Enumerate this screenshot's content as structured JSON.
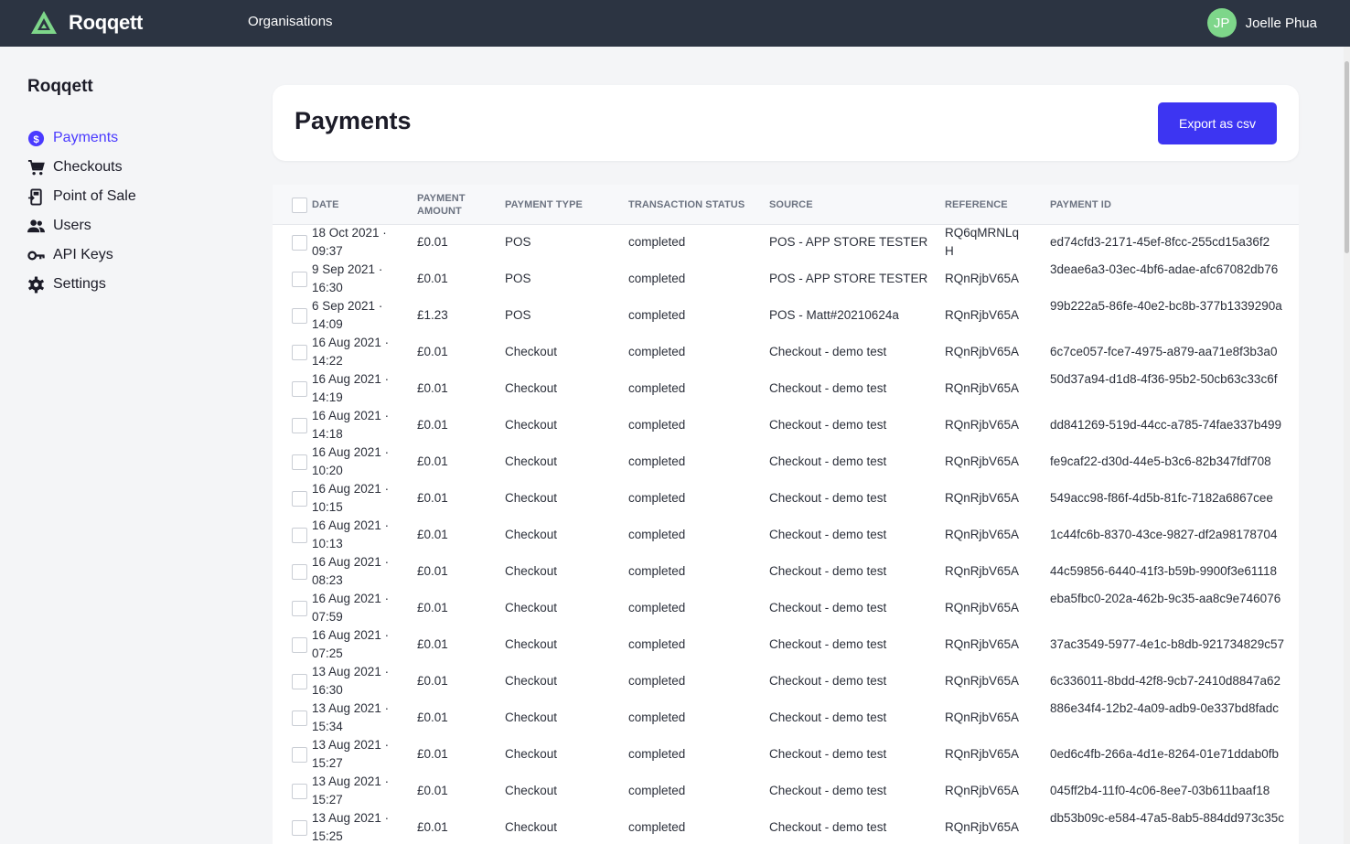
{
  "brand": {
    "name": "Roqqett",
    "logo_icon": "roqqett-logo-icon",
    "accent": "#7ed68a"
  },
  "topnav": {
    "organisations": "Organisations"
  },
  "user": {
    "initials": "JP",
    "name": "Joelle Phua"
  },
  "sidebar": {
    "org_name": "Roqqett",
    "items": [
      {
        "label": "Payments",
        "icon": "dollar-icon",
        "active": true
      },
      {
        "label": "Checkouts",
        "icon": "cart-icon",
        "active": false
      },
      {
        "label": "Point of Sale",
        "icon": "pos-icon",
        "active": false
      },
      {
        "label": "Users",
        "icon": "users-icon",
        "active": false
      },
      {
        "label": "API Keys",
        "icon": "key-icon",
        "active": false
      },
      {
        "label": "Settings",
        "icon": "gear-icon",
        "active": false
      }
    ]
  },
  "header": {
    "title": "Payments",
    "export_label": "Export as csv",
    "export_color": "#3d35f2"
  },
  "table": {
    "columns": {
      "date": "DATE",
      "amount": "PAYMENT AMOUNT",
      "type": "PAYMENT TYPE",
      "status": "TRANSACTION STATUS",
      "source": "SOURCE",
      "reference": "REFERENCE",
      "payment_id": "PAYMENT ID"
    },
    "rows": [
      {
        "date": "18 Oct 2021 · 09:37",
        "amount": "£0.01",
        "type": "POS",
        "status": "completed",
        "source": "POS - APP STORE TESTER",
        "reference": "RQ6qMRNLqH",
        "payment_id": "ed74cfd3-2171-45ef-8fcc-255cd15a36f2"
      },
      {
        "date": "9 Sep 2021 · 16:30",
        "amount": "£0.01",
        "type": "POS",
        "status": "completed",
        "source": "POS - APP STORE TESTER",
        "reference": "RQnRjbV65A",
        "payment_id": "3deae6a3-03ec-4bf6-adae-afc67082db76"
      },
      {
        "date": "6 Sep 2021 · 14:09",
        "amount": "£1.23",
        "type": "POS",
        "status": "completed",
        "source": "POS - Matt#20210624a",
        "reference": "RQnRjbV65A",
        "payment_id": "99b222a5-86fe-40e2-bc8b-377b1339290a"
      },
      {
        "date": "16 Aug 2021 · 14:22",
        "amount": "£0.01",
        "type": "Checkout",
        "status": "completed",
        "source": "Checkout - demo test",
        "reference": "RQnRjbV65A",
        "payment_id": "6c7ce057-fce7-4975-a879-aa71e8f3b3a0"
      },
      {
        "date": "16 Aug 2021 · 14:19",
        "amount": "£0.01",
        "type": "Checkout",
        "status": "completed",
        "source": "Checkout - demo test",
        "reference": "RQnRjbV65A",
        "payment_id": "50d37a94-d1d8-4f36-95b2-50cb63c33c6f"
      },
      {
        "date": "16 Aug 2021 · 14:18",
        "amount": "£0.01",
        "type": "Checkout",
        "status": "completed",
        "source": "Checkout - demo test",
        "reference": "RQnRjbV65A",
        "payment_id": "dd841269-519d-44cc-a785-74fae337b499"
      },
      {
        "date": "16 Aug 2021 · 10:20",
        "amount": "£0.01",
        "type": "Checkout",
        "status": "completed",
        "source": "Checkout - demo test",
        "reference": "RQnRjbV65A",
        "payment_id": "fe9caf22-d30d-44e5-b3c6-82b347fdf708"
      },
      {
        "date": "16 Aug 2021 · 10:15",
        "amount": "£0.01",
        "type": "Checkout",
        "status": "completed",
        "source": "Checkout - demo test",
        "reference": "RQnRjbV65A",
        "payment_id": "549acc98-f86f-4d5b-81fc-7182a6867cee"
      },
      {
        "date": "16 Aug 2021 · 10:13",
        "amount": "£0.01",
        "type": "Checkout",
        "status": "completed",
        "source": "Checkout - demo test",
        "reference": "RQnRjbV65A",
        "payment_id": "1c44fc6b-8370-43ce-9827-df2a98178704"
      },
      {
        "date": "16 Aug 2021 · 08:23",
        "amount": "£0.01",
        "type": "Checkout",
        "status": "completed",
        "source": "Checkout - demo test",
        "reference": "RQnRjbV65A",
        "payment_id": "44c59856-6440-41f3-b59b-9900f3e61118"
      },
      {
        "date": "16 Aug 2021 · 07:59",
        "amount": "£0.01",
        "type": "Checkout",
        "status": "completed",
        "source": "Checkout - demo test",
        "reference": "RQnRjbV65A",
        "payment_id": "eba5fbc0-202a-462b-9c35-aa8c9e746076"
      },
      {
        "date": "16 Aug 2021 · 07:25",
        "amount": "£0.01",
        "type": "Checkout",
        "status": "completed",
        "source": "Checkout - demo test",
        "reference": "RQnRjbV65A",
        "payment_id": "37ac3549-5977-4e1c-b8db-921734829c57"
      },
      {
        "date": "13 Aug 2021 · 16:30",
        "amount": "£0.01",
        "type": "Checkout",
        "status": "completed",
        "source": "Checkout - demo test",
        "reference": "RQnRjbV65A",
        "payment_id": "6c336011-8bdd-42f8-9cb7-2410d8847a62"
      },
      {
        "date": "13 Aug 2021 · 15:34",
        "amount": "£0.01",
        "type": "Checkout",
        "status": "completed",
        "source": "Checkout - demo test",
        "reference": "RQnRjbV65A",
        "payment_id": "886e34f4-12b2-4a09-adb9-0e337bd8fadc"
      },
      {
        "date": "13 Aug 2021 · 15:27",
        "amount": "£0.01",
        "type": "Checkout",
        "status": "completed",
        "source": "Checkout - demo test",
        "reference": "RQnRjbV65A",
        "payment_id": "0ed6c4fb-266a-4d1e-8264-01e71ddab0fb"
      },
      {
        "date": "13 Aug 2021 · 15:27",
        "amount": "£0.01",
        "type": "Checkout",
        "status": "completed",
        "source": "Checkout - demo test",
        "reference": "RQnRjbV65A",
        "payment_id": "045ff2b4-11f0-4c06-8ee7-03b611baaf18"
      },
      {
        "date": "13 Aug 2021 · 15:25",
        "amount": "£0.01",
        "type": "Checkout",
        "status": "completed",
        "source": "Checkout - demo test",
        "reference": "RQnRjbV65A",
        "payment_id": "db53b09c-e584-47a5-8ab5-884dd973c35c"
      }
    ]
  }
}
